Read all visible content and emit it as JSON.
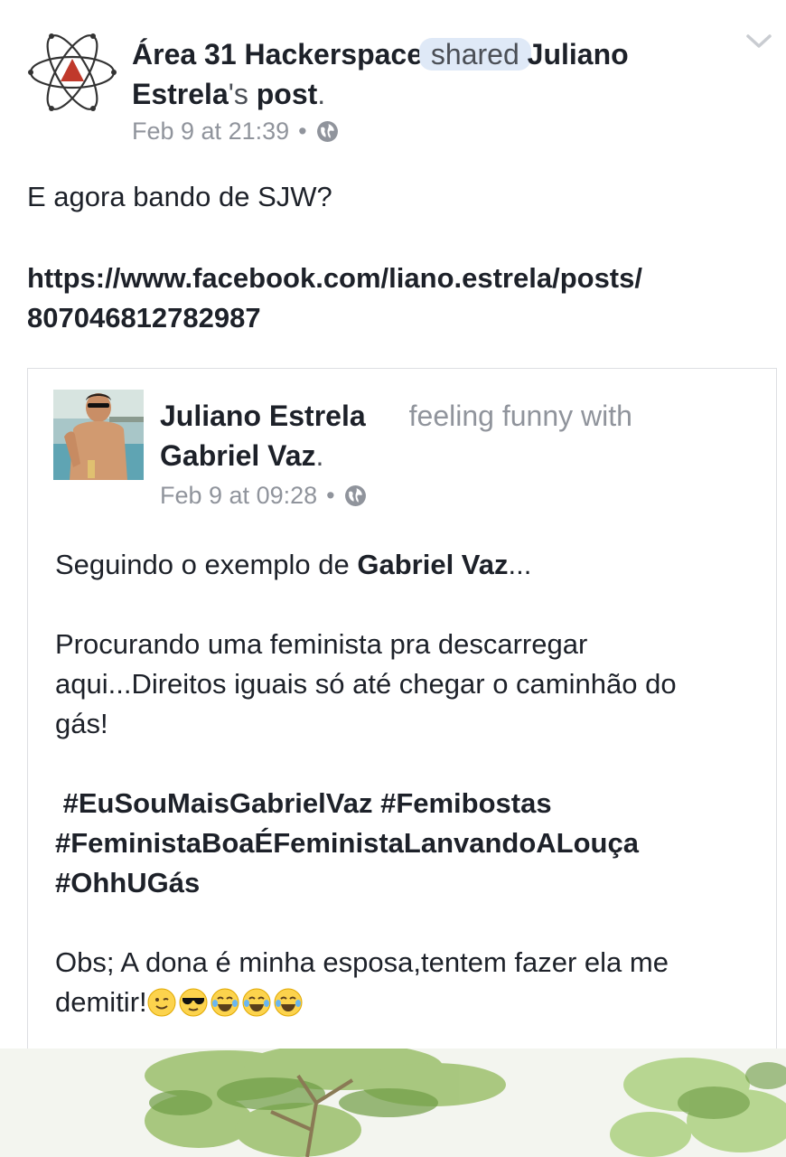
{
  "post": {
    "page_name": "Área 31 Hackerspace",
    "shared_word": " shared ",
    "original_author": "Juliano Estrela",
    "possessive": "'s ",
    "post_word": "post",
    "period": ".",
    "timestamp": "Feb 9 at 21:39",
    "separator": "•",
    "text": "E agora bando de SJW?",
    "link_line1": "https://www.facebook.com/liano.estrela/posts/",
    "link_line2": "807046812782987"
  },
  "embed": {
    "author": "Juliano Estrela",
    "feeling": "feeling funny with",
    "tagged": "Gabriel Vaz",
    "period": ".",
    "timestamp": "Feb 9 at 09:28",
    "separator": "•",
    "line1_prefix": "Seguindo o exemplo de ",
    "line1_name": "Gabriel Vaz",
    "line1_suffix": "...",
    "para2_line1": "Procurando uma feminista pra descarregar",
    "para2_line2": "aqui...Direitos iguais só até chegar o caminhão do",
    "para2_line3": "gás!",
    "hashtag1": " #EuSouMaisGabrielVaz #Femibostas",
    "hashtag2": "#FeministaBoaÉFeministaLanvandoALouça",
    "hashtag3": "#OhhUGás",
    "obs_line1": "Obs; A dona é minha esposa,tentem fazer ela me",
    "obs_line2": "demitir!"
  },
  "icons": {
    "page_logo": "atom-logo-icon",
    "globe": "globe-icon",
    "chevron": "chevron-down-icon",
    "emojis": [
      "wink-face-icon",
      "sunglasses-face-icon",
      "tears-of-joy-icon",
      "tears-of-joy-icon",
      "tears-of-joy-icon"
    ]
  },
  "colors": {
    "text": "#1d2129",
    "muted": "#90949c",
    "highlight": "#dfe9f7",
    "border": "#dddfe2",
    "logo_triangle": "#c0392b"
  }
}
